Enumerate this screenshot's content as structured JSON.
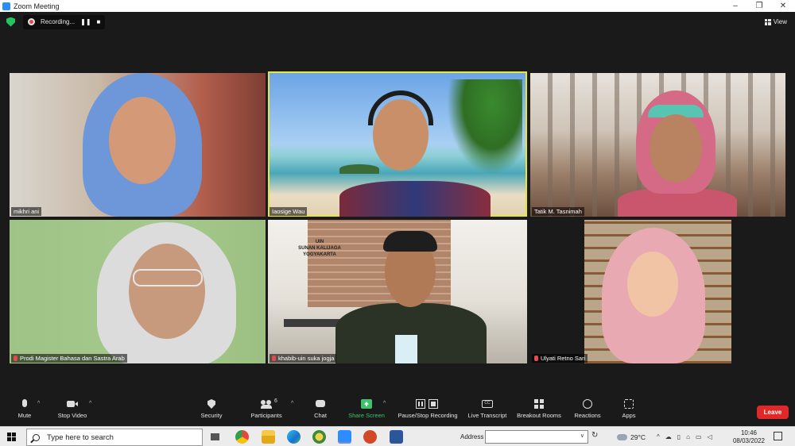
{
  "window": {
    "title": "Zoom Meeting",
    "controls": {
      "minimize": "–",
      "maximize": "❐",
      "close": "✕"
    }
  },
  "recording": {
    "label": "Recording...",
    "pause_glyph": "❚❚",
    "stop_glyph": "■"
  },
  "view": {
    "label": "View"
  },
  "participants": [
    {
      "name": "mikhri ani",
      "muted": false
    },
    {
      "name": "Iaosige Wau",
      "muted": false,
      "active_speaker": true
    },
    {
      "name": "Tatik M. Tasnimah",
      "muted": false
    },
    {
      "name": "Prodi Magister Bahasa dan Sastra Arab",
      "muted": true
    },
    {
      "name": "khabib-uin suka jogja",
      "muted": true
    },
    {
      "name": "Ulyati Retno Sari",
      "muted": true
    }
  ],
  "background_sign": {
    "line1": "UIN",
    "line2": "SUNAN KALIJAGA",
    "line3": "YOGYAKARTA"
  },
  "toolbar": {
    "mute": "Mute",
    "stop_video": "Stop Video",
    "security": "Security",
    "participants": "Participants",
    "participants_count": "6",
    "chat": "Chat",
    "share_screen": "Share Screen",
    "pause_stop_recording": "Pause/Stop Recording",
    "live_transcript": "Live Transcript",
    "breakout_rooms": "Breakout Rooms",
    "reactions": "Reactions",
    "apps": "Apps",
    "leave": "Leave",
    "cc_glyph": "CC"
  },
  "taskbar": {
    "search_placeholder": "Type here to search",
    "address_label": "Address",
    "temperature": "29°C",
    "time": "10:46",
    "date": "08/03/2022"
  },
  "colors": {
    "accent_speaker": "#e8e53c",
    "leave_red": "#e02828",
    "share_green": "#3ec26a",
    "zoom_blue": "#2d8cff"
  }
}
